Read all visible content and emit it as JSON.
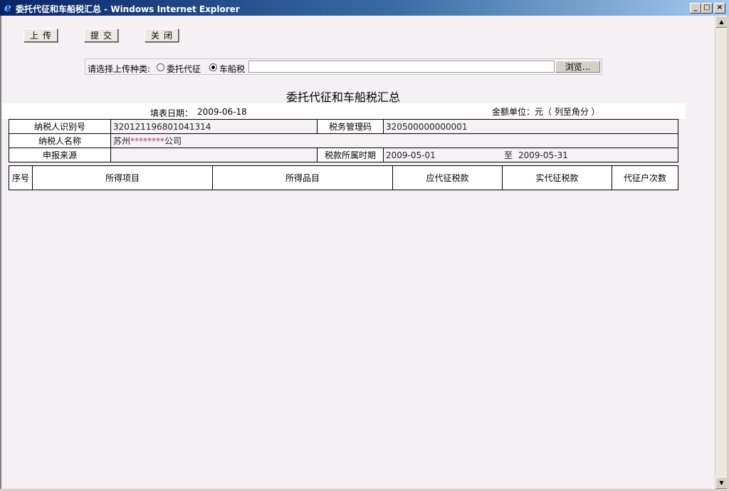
{
  "window": {
    "title": "委托代征和车船税汇总 - Windows Internet Explorer",
    "logo_glyph": "e",
    "min_glyph": "_",
    "max_glyph": "□",
    "close_glyph": "×"
  },
  "toolbar": {
    "upload_label": "上传",
    "submit_label": "提交",
    "close_label": "关闭"
  },
  "upload": {
    "prompt": "请选择上传种类:",
    "option1": "委托代征",
    "option2": "车船税",
    "selected": "车船税",
    "file_value": "",
    "browse_label": "浏览..."
  },
  "report": {
    "title": "委托代征和车船税汇总",
    "fill_date_label": "填表日期：",
    "fill_date": "2009-06-18",
    "unit": "金额单位：元（ 列至角分 ）"
  },
  "form": {
    "taxpayer_id_label": "纳税人识别号",
    "taxpayer_id": "320121196801041314",
    "tax_code_label": "税务管理码",
    "tax_code": "320500000000001",
    "taxpayer_name_label": "纳税人名称",
    "taxpayer_name_prefix": "苏州",
    "taxpayer_name_mask": "********",
    "taxpayer_name_suffix": "公司",
    "source_label": "申报来源",
    "source": "",
    "period_label": "税款所属时期",
    "period_start": "2009-05-01",
    "period_to": "至",
    "period_end": "2009-05-31"
  },
  "grid": {
    "columns": [
      "序号",
      "所得项目",
      "所得品目",
      "应代征税款",
      "实代征税款",
      "代征户次数"
    ]
  },
  "scrollbar": {
    "up_glyph": "▲",
    "down_glyph": "▼"
  }
}
